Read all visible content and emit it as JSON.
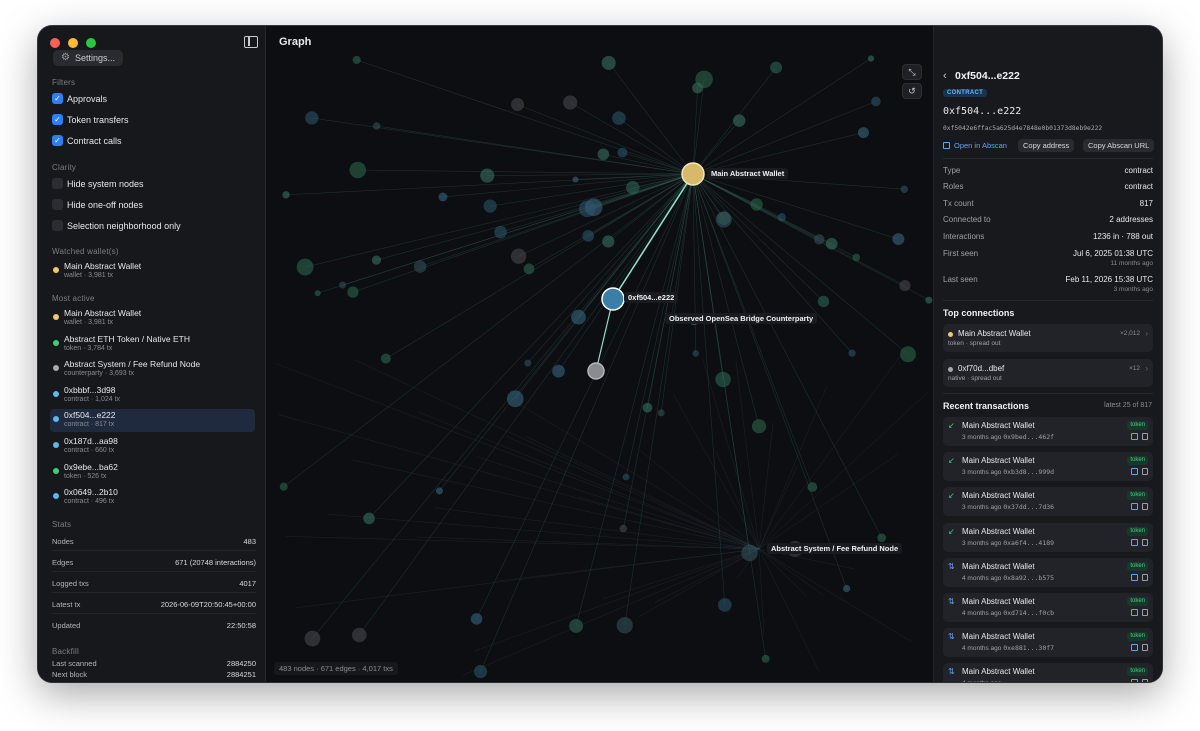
{
  "app": {
    "graph_title": "Graph",
    "settings_label": "Settings..."
  },
  "filters": {
    "title": "Filters",
    "items": [
      {
        "label": "Approvals",
        "checked": true
      },
      {
        "label": "Token transfers",
        "checked": true
      },
      {
        "label": "Contract calls",
        "checked": true
      }
    ]
  },
  "clarity": {
    "title": "Clarity",
    "items": [
      {
        "label": "Hide system nodes",
        "checked": false
      },
      {
        "label": "Hide one-off nodes",
        "checked": false
      },
      {
        "label": "Selection neighborhood only",
        "checked": false
      }
    ]
  },
  "watched": {
    "title": "Watched wallet(s)",
    "items": [
      {
        "name": "Main Abstract Wallet",
        "sub": "wallet · 3,981 tx",
        "color": "#f2c66d"
      }
    ]
  },
  "most_active": {
    "title": "Most active",
    "items": [
      {
        "name": "Main Abstract Wallet",
        "sub": "wallet · 3,981 tx",
        "color": "#f2c66d"
      },
      {
        "name": "Abstract ETH Token / Native ETH",
        "sub": "token · 3,784 tx",
        "color": "#3fcf7a"
      },
      {
        "name": "Abstract System / Fee Refund Node",
        "sub": "counterparty · 3,693 tx",
        "color": "#a8a9af"
      },
      {
        "name": "0xbbbf...3d98",
        "sub": "contract · 1,024 tx",
        "color": "#5ab8f0"
      },
      {
        "name": "0xf504...e222",
        "sub": "contract · 817 tx",
        "color": "#5ab8f0"
      },
      {
        "name": "0x187d...aa98",
        "sub": "contract · 660 tx",
        "color": "#5ab8f0"
      },
      {
        "name": "0x9ebe...ba62",
        "sub": "token · 526 tx",
        "color": "#3fcf7a"
      },
      {
        "name": "0x0649...2b10",
        "sub": "contract · 496 tx",
        "color": "#5ab8f0"
      }
    ]
  },
  "stats": {
    "title": "Stats",
    "rows": [
      {
        "k": "Nodes",
        "v": "483"
      },
      {
        "k": "Edges",
        "v": "671 (20748 interactions)"
      },
      {
        "k": "Logged txs",
        "v": "4017"
      },
      {
        "k": "Latest tx",
        "v": "2026-06-09T20:50:45+00:00"
      },
      {
        "k": "Updated",
        "v": "22:50:58"
      }
    ]
  },
  "backfill": {
    "title": "Backfill",
    "rows": [
      {
        "k": "Last scanned",
        "v": "2884250"
      },
      {
        "k": "Next block",
        "v": "2884251"
      }
    ]
  },
  "graph": {
    "footer": "483 nodes · 671 edges · 4,017 txs",
    "labels": {
      "main": "Main Abstract Wallet",
      "selected": "0xf504...e222",
      "opensea": "Observed OpenSea Bridge Counterparty",
      "system": "Abstract System / Fee Refund Node"
    }
  },
  "detail": {
    "title": "0xf504...e222",
    "badge": "CONTRACT",
    "addr_short": "0xf504...e222",
    "addr_full": "0xf5042e6ffac5a625d4e7848e0b01373d8eb9e222",
    "open_link": "Open in Abscan",
    "copy_address": "Copy address",
    "copy_url": "Copy Abscan URL",
    "props": [
      {
        "k": "Type",
        "v": "contract"
      },
      {
        "k": "Roles",
        "v": "contract"
      },
      {
        "k": "Tx count",
        "v": "817"
      },
      {
        "k": "Connected to",
        "v": "2 addresses"
      },
      {
        "k": "Interactions",
        "v": "1236 in · 788 out"
      },
      {
        "k": "First seen",
        "v": "Jul 6, 2025 01:38 UTC",
        "sub": "11 months ago"
      },
      {
        "k": "Last seen",
        "v": "Feb 11, 2026 15:38 UTC",
        "sub": "3 months ago"
      }
    ],
    "top_connections_title": "Top connections",
    "top_connections": [
      {
        "name": "Main Abstract Wallet",
        "sub": "token · spread out",
        "count": "×2,012",
        "color": "#f2c66d"
      },
      {
        "name": "0xf70d...dbef",
        "sub": "native · spread out",
        "count": "×12",
        "color": "#a8a9af"
      }
    ],
    "recent_title": "Recent transactions",
    "recent_aux": "latest 25 of 817",
    "recent": [
      {
        "name": "Main Abstract Wallet",
        "time": "3 months ago",
        "hash": "0x9bed...462f",
        "tag": "token",
        "dir": "in"
      },
      {
        "name": "Main Abstract Wallet",
        "time": "3 months ago",
        "hash": "0xb3d8...999d",
        "tag": "token",
        "dir": "in"
      },
      {
        "name": "Main Abstract Wallet",
        "time": "3 months ago",
        "hash": "0x37dd...7d36",
        "tag": "token",
        "dir": "in"
      },
      {
        "name": "Main Abstract Wallet",
        "time": "3 months ago",
        "hash": "0xa6f4...4189",
        "tag": "token",
        "dir": "in"
      },
      {
        "name": "Main Abstract Wallet",
        "time": "4 months ago",
        "hash": "0x8a92...b575",
        "tag": "token",
        "dir": "bi"
      },
      {
        "name": "Main Abstract Wallet",
        "time": "4 months ago",
        "hash": "0xd714...f0cb",
        "tag": "token",
        "dir": "bi"
      },
      {
        "name": "Main Abstract Wallet",
        "time": "4 months ago",
        "hash": "0xe881...30f7",
        "tag": "token",
        "dir": "bi"
      },
      {
        "name": "Main Abstract Wallet",
        "time": "4 months ago",
        "hash": "",
        "tag": "token",
        "dir": "bi"
      }
    ]
  }
}
